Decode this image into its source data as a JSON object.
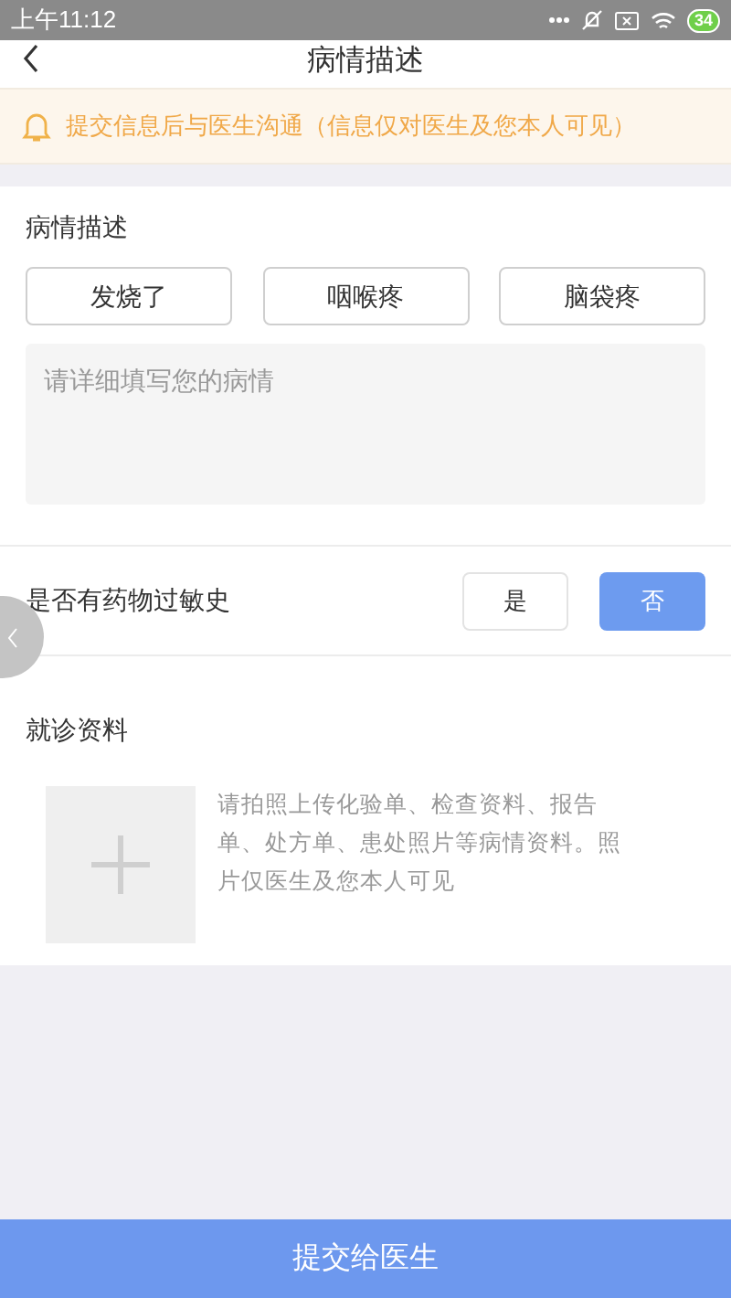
{
  "status_bar": {
    "time": "上午11:12",
    "battery": "34"
  },
  "header": {
    "title": "病情描述"
  },
  "notice": {
    "text": "提交信息后与医生沟通（信息仅对医生及您本人可见）"
  },
  "condition": {
    "title": "病情描述",
    "symptoms": [
      {
        "label": "发烧了",
        "selected": false
      },
      {
        "label": "咽喉疼",
        "selected": false
      },
      {
        "label": "脑袋疼",
        "selected": false
      }
    ],
    "description": {
      "placeholder": "请详细填写您的病情"
    }
  },
  "allergy": {
    "label": "是否有药物过敏史",
    "options": [
      {
        "label": "是",
        "selected": false
      },
      {
        "label": "否",
        "selected": true
      }
    ]
  },
  "materials": {
    "title": "就诊资料",
    "hint": "请拍照上传化验单、检查资料、报告单、处方单、患处照片等病情资料。照片仅医生及您本人可见"
  },
  "submit": {
    "label": "提交给医生"
  }
}
